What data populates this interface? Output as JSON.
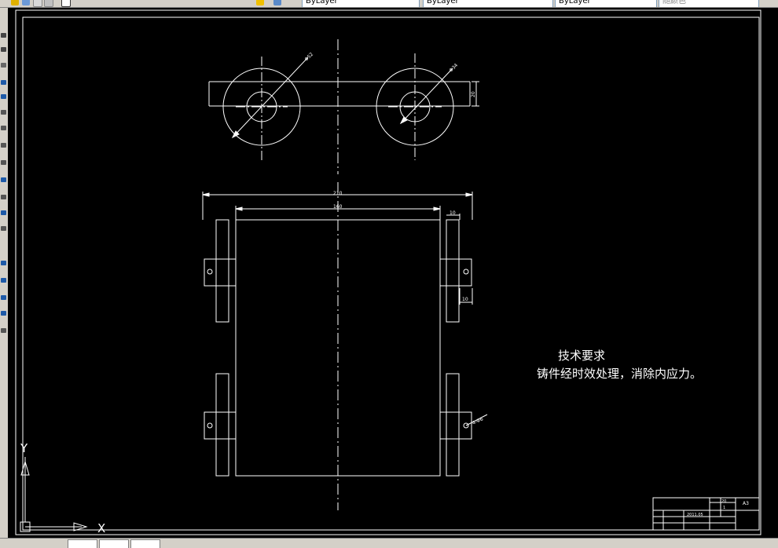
{
  "toolbar": {
    "layer_dropdown": "ByLayer",
    "linetype_dropdown": "ByLayer",
    "lineweight_dropdown": "ByLayer",
    "plotstyle_dropdown": "随颜色"
  },
  "drawing": {
    "dims": {
      "hole_dia_left": "Φ52",
      "hole_dia_right": "Φ34",
      "height_top": "20",
      "overall_width": "210",
      "inner_width": "160",
      "flange_width": "10",
      "flange_offset": "10",
      "hole_callout": "4-Φ6"
    },
    "notes": {
      "heading": "技术要求",
      "text": "铸件经时效处理，消除内应力。"
    },
    "title_block": {
      "scale": "20",
      "sheet": "A3",
      "qty": "1",
      "date": "2011.05"
    },
    "ucs": {
      "y_label": "Y",
      "x_label": "X"
    }
  },
  "colors": {
    "canvas_bg": "#000000",
    "line": "#ffffff",
    "center_line": "#ffffff"
  }
}
